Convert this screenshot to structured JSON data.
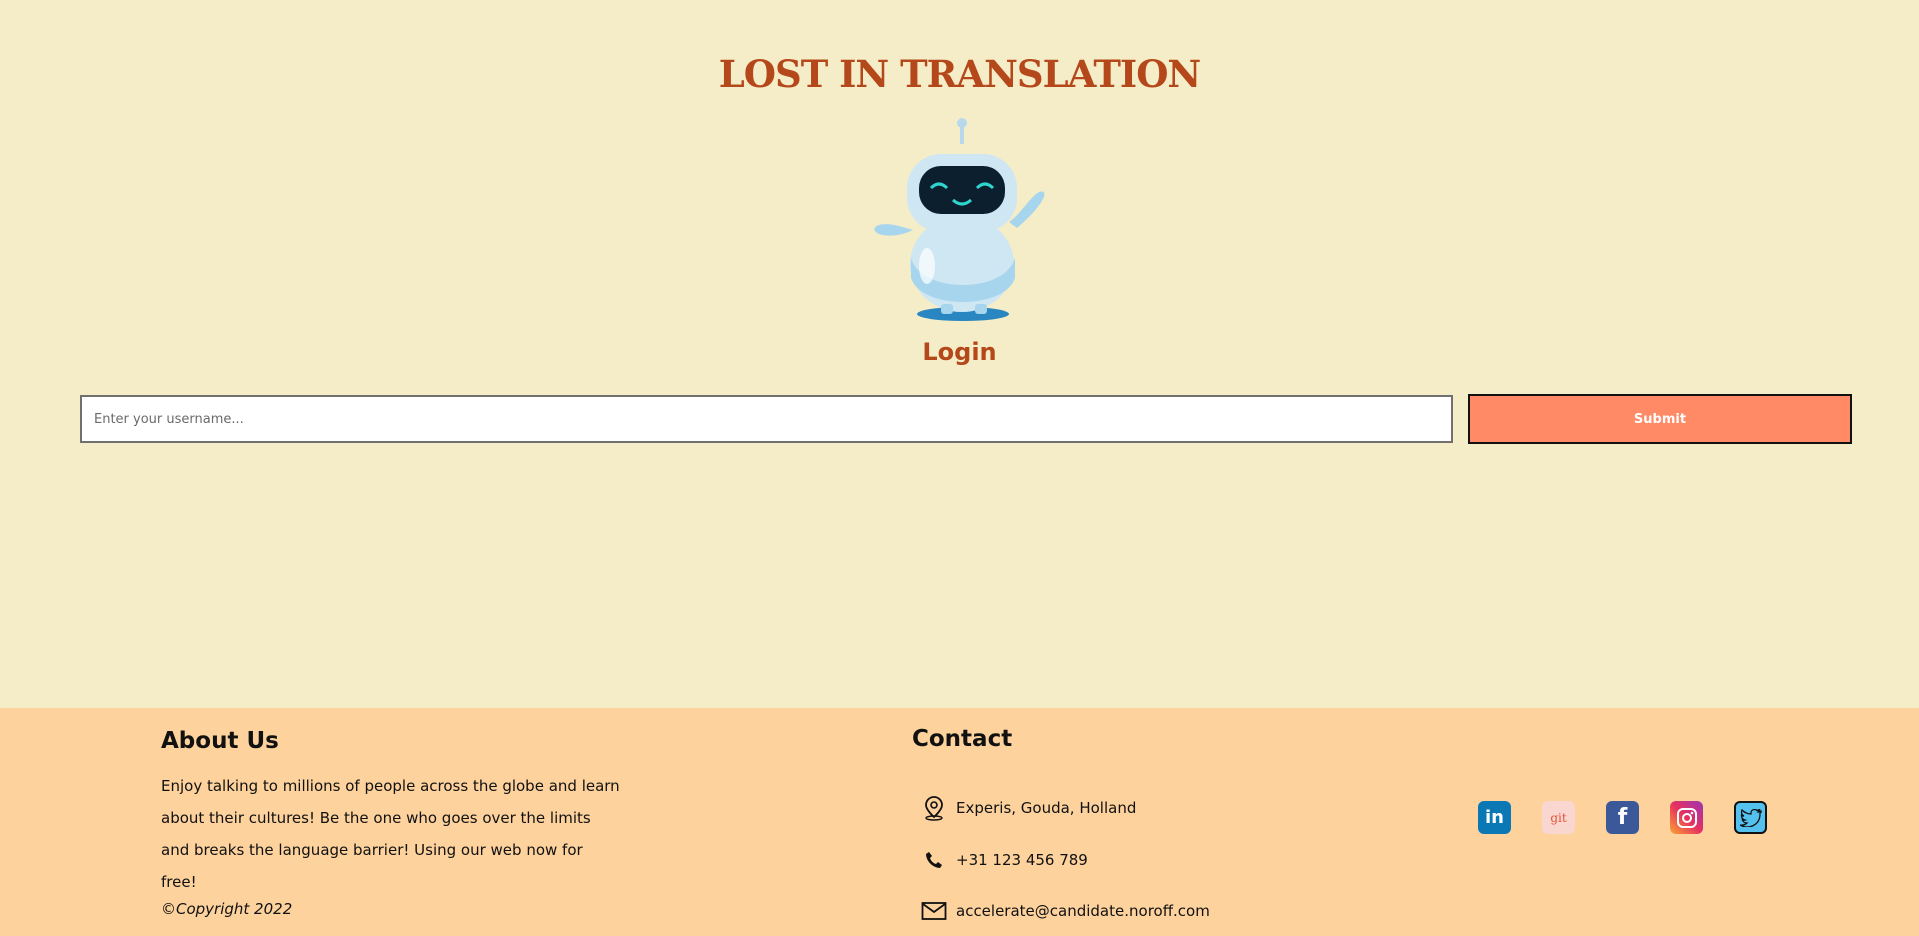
{
  "header": {
    "title": "LOST IN TRANSLATION"
  },
  "login": {
    "heading": "Login",
    "username_placeholder": "Enter your username...",
    "submit_label": "Submit"
  },
  "footer": {
    "about": {
      "title": "About Us",
      "text": "Enjoy talking to millions of people across the globe and learn about their cultures! Be the one who goes over the limits and breaks the language barrier! Using our web now for free!",
      "copyright": "©Copyright 2022"
    },
    "contact": {
      "title": "Contact",
      "address": "Experis, Gouda, Holland",
      "phone": "+31 123 456 789",
      "email": "accelerate@candidate.noroff.com"
    },
    "socials": [
      {
        "name": "linkedin",
        "text": "in",
        "color": "#0b78b6"
      },
      {
        "name": "git",
        "text": "git",
        "color": "#f9d6cf"
      },
      {
        "name": "facebook",
        "text": "f",
        "color": "#3b5998"
      },
      {
        "name": "instagram",
        "color": "#e6305f"
      },
      {
        "name": "twitter",
        "color": "#55c1ef"
      }
    ]
  },
  "colors": {
    "background": "#f5edc8",
    "footer_background": "#fdd29d",
    "accent": "#b5481a",
    "submit": "#ff8a65"
  }
}
